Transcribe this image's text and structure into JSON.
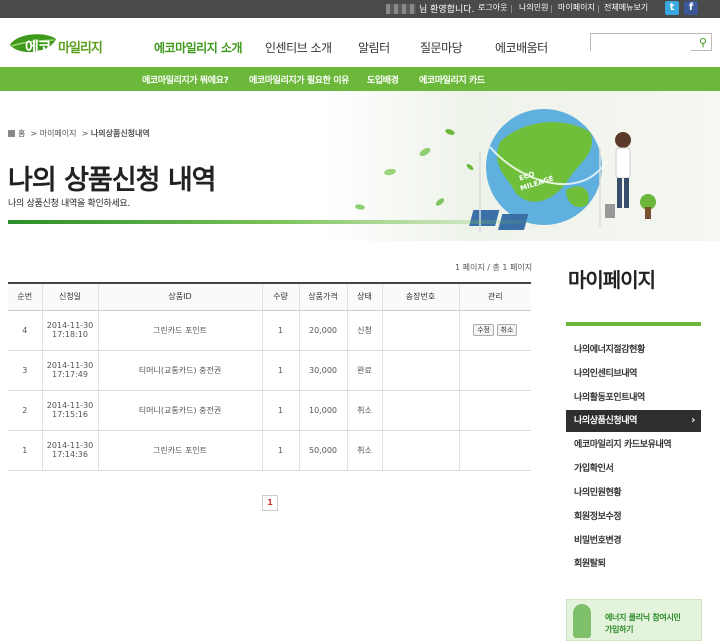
{
  "topbar": {
    "greeting": "님 환영합니다.",
    "links": [
      "로그아웃",
      "나의민원",
      "마이페이지",
      "전체메뉴보기"
    ],
    "twitter": "t",
    "facebook": "f"
  },
  "header": {
    "logo_text_a": "에코",
    "logo_text_b": "마일리지",
    "nav": [
      "에코마일리지 소개",
      "인센티브 소개",
      "알림터",
      "질문마당",
      "에코배움터"
    ],
    "search_placeholder": ""
  },
  "subnav": [
    "에코마일리지가 뭐에요?",
    "에코마일리지가 필요한 이유",
    "도입배경",
    "에코마일리지 카드"
  ],
  "page": {
    "breadcrumb_home": "홈",
    "breadcrumb_1": "마이페이지",
    "breadcrumb_2": "나의상품신청내역",
    "title": "나의 상품신청 내역",
    "desc": "나의 상품신청 내역을 확인하세요.",
    "hero_badge": "ECO MILEAGE",
    "page_info": "1 페이지 / 총 1 페이지"
  },
  "table": {
    "headers": [
      "순번",
      "신청일",
      "상품ID",
      "수량",
      "상품가격",
      "상태",
      "송장번호",
      "관리"
    ],
    "rows": [
      {
        "no": "4",
        "date": "2014-11-30",
        "time": "17:18:10",
        "product": "그린카드 포인트",
        "qty": "1",
        "price": "20,000",
        "status": "신청",
        "invoice": "",
        "edit": "수정",
        "cancel": "취소"
      },
      {
        "no": "3",
        "date": "2014-11-30",
        "time": "17:17:49",
        "product": "티머니(교통카드) 충전권",
        "qty": "1",
        "price": "30,000",
        "status": "완료",
        "invoice": ""
      },
      {
        "no": "2",
        "date": "2014-11-30",
        "time": "17:15:16",
        "product": "티머니(교통카드) 충전권",
        "qty": "1",
        "price": "10,000",
        "status": "취소",
        "invoice": ""
      },
      {
        "no": "1",
        "date": "2014-11-30",
        "time": "17:14:36",
        "product": "그린카드 포인트",
        "qty": "1",
        "price": "50,000",
        "status": "취소",
        "invoice": ""
      }
    ],
    "current_page": "1"
  },
  "side": {
    "title": "마이페이지",
    "items": [
      "나의에너지절감현황",
      "나의인센티브내역",
      "나의활동포인트내역",
      "나의상품신청내역",
      "에코마일리지 카드보유내역",
      "가입확인서",
      "나의민원현황",
      "회원정보수정",
      "비밀번호변경",
      "회원탈퇴"
    ],
    "active_arrow": "›",
    "banner_line1": "에너지 클리닉 참여시민",
    "banner_line2": "가입하기"
  },
  "colors": {
    "accent": "#6bb83a",
    "brand_green": "#3f9a1c",
    "topbar": "#4a4a4a",
    "twitter": "#3aa8e0",
    "facebook": "#3b5998"
  }
}
